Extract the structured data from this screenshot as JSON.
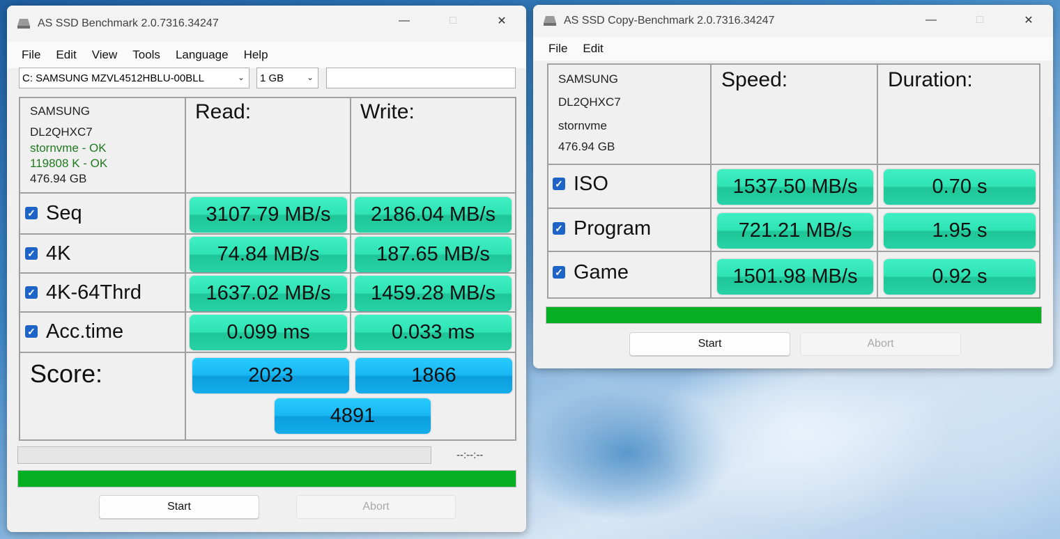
{
  "bench": {
    "title": "AS SSD Benchmark 2.0.7316.34247",
    "menu": [
      "File",
      "Edit",
      "View",
      "Tools",
      "Language",
      "Help"
    ],
    "drive_select": "C: SAMSUNG MZVL4512HBLU-00BLL",
    "size_select": "1 GB",
    "info": {
      "model": "SAMSUNG",
      "firmware": "DL2QHXC7",
      "driver": "stornvme - OK",
      "alignment": "119808 K - OK",
      "capacity": "476.94 GB"
    },
    "headers": {
      "read": "Read:",
      "write": "Write:"
    },
    "rows": [
      {
        "label": "Seq",
        "read": "3107.79 MB/s",
        "write": "2186.04 MB/s"
      },
      {
        "label": "4K",
        "read": "74.84 MB/s",
        "write": "187.65 MB/s"
      },
      {
        "label": "4K-64Thrd",
        "read": "1637.02 MB/s",
        "write": "1459.28 MB/s"
      },
      {
        "label": "Acc.time",
        "read": "0.099 ms",
        "write": "0.033 ms"
      }
    ],
    "score": {
      "label": "Score:",
      "read": "2023",
      "write": "1866",
      "total": "4891"
    },
    "timer": "--:--:--",
    "progress": 1.0,
    "start_label": "Start",
    "abort_label": "Abort"
  },
  "copy": {
    "title": "AS SSD Copy-Benchmark 2.0.7316.34247",
    "menu": [
      "File",
      "Edit"
    ],
    "info": {
      "model": "SAMSUNG",
      "firmware": "DL2QHXC7",
      "driver": "stornvme",
      "capacity": "476.94 GB"
    },
    "headers": {
      "speed": "Speed:",
      "duration": "Duration:"
    },
    "rows": [
      {
        "label": "ISO",
        "speed": "1537.50 MB/s",
        "duration": "0.70 s"
      },
      {
        "label": "Program",
        "speed": "721.21 MB/s",
        "duration": "1.95 s"
      },
      {
        "label": "Game",
        "speed": "1501.98 MB/s",
        "duration": "0.92 s"
      }
    ],
    "progress": 1.0,
    "start_label": "Start",
    "abort_label": "Abort"
  },
  "colors": {
    "result_green": "#2fe3b4",
    "score_blue": "#19b8f4",
    "progress_green": "#06b025",
    "checkbox_blue": "#1e63c6"
  }
}
